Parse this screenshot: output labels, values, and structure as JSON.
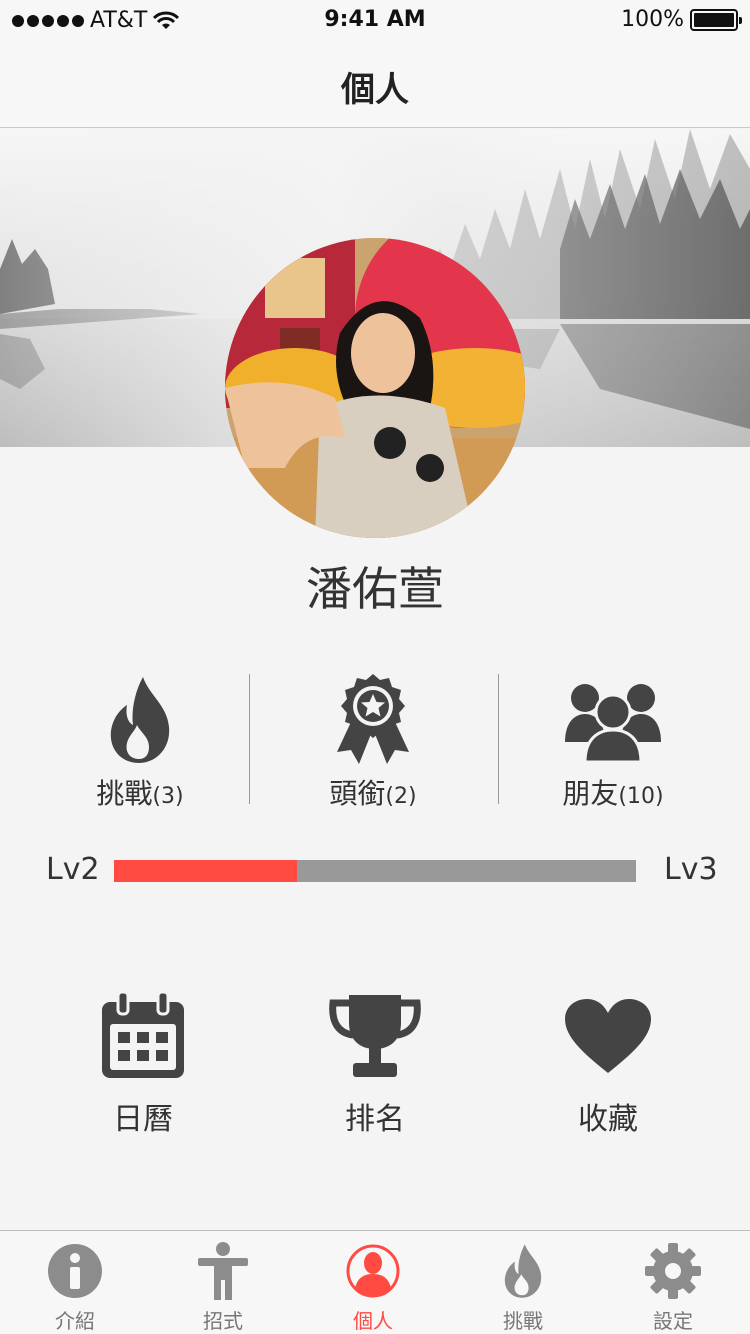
{
  "status_bar": {
    "carrier": "AT&T",
    "time": "9:41 AM",
    "battery": "100%"
  },
  "nav": {
    "title": "個人"
  },
  "profile": {
    "name": "潘佑萱"
  },
  "stats": [
    {
      "label": "挑戰",
      "count": "(3)",
      "icon": "flame-icon"
    },
    {
      "label": "頭銜",
      "count": "(2)",
      "icon": "award-ribbon-icon"
    },
    {
      "label": "朋友",
      "count": "(10)",
      "icon": "friends-group-icon"
    }
  ],
  "level": {
    "current": "Lv2",
    "next": "Lv3",
    "progress": 0.35,
    "progress_color": "#ff4b41",
    "track_color": "#999999"
  },
  "actions": [
    {
      "label": "日曆",
      "icon": "calendar-icon"
    },
    {
      "label": "排名",
      "icon": "trophy-icon"
    },
    {
      "label": "收藏",
      "icon": "heart-icon"
    }
  ],
  "tabs": [
    {
      "label": "介紹",
      "icon": "info-icon",
      "active": false
    },
    {
      "label": "招式",
      "icon": "person-stance-icon",
      "active": false
    },
    {
      "label": "個人",
      "icon": "profile-icon",
      "active": true
    },
    {
      "label": "挑戰",
      "icon": "flame-icon",
      "active": false
    },
    {
      "label": "設定",
      "icon": "gear-icon",
      "active": false
    }
  ],
  "colors": {
    "accent": "#ff4b41",
    "icon_dark": "#444444",
    "icon_gray": "#8c8c8c",
    "background": "#f4f4f4"
  }
}
